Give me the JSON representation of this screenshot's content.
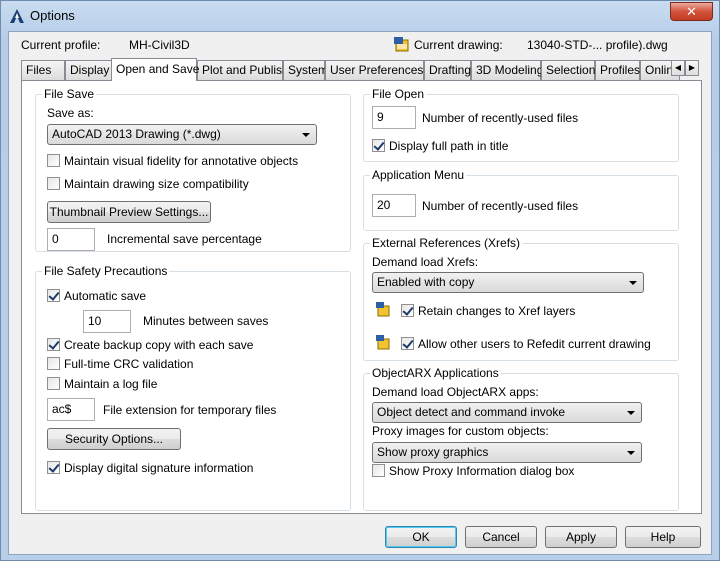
{
  "window": {
    "title": "Options",
    "close_label": "✕"
  },
  "header": {
    "current_profile_label": "Current profile:",
    "current_profile_value": "MH-Civil3D",
    "current_drawing_label": "Current drawing:",
    "current_drawing_value": "13040-STD-... profile).dwg"
  },
  "tabs": [
    "Files",
    "Display",
    "Open and Save",
    "Plot and Publish",
    "System",
    "User Preferences",
    "Drafting",
    "3D Modeling",
    "Selection",
    "Profiles",
    "Online"
  ],
  "active_tab": "Open and Save",
  "file_save": {
    "title": "File Save",
    "save_as_label": "Save as:",
    "save_as_value": "AutoCAD 2013 Drawing (*.dwg)",
    "visual_fidelity_label": "Maintain visual fidelity for annotative objects",
    "visual_fidelity_checked": false,
    "drawing_size_label": "Maintain drawing size compatibility",
    "drawing_size_checked": false,
    "thumbnail_button": "Thumbnail Preview Settings...",
    "incremental_value": "0",
    "incremental_label": "Incremental save percentage"
  },
  "file_safety": {
    "title": "File Safety Precautions",
    "automatic_save_label": "Automatic save",
    "automatic_save_checked": true,
    "minutes_value": "10",
    "minutes_label": "Minutes between saves",
    "backup_label": "Create backup copy with each save",
    "backup_checked": true,
    "crc_label": "Full-time CRC validation",
    "crc_checked": false,
    "log_label": "Maintain a log file",
    "log_checked": false,
    "temp_ext_value": "ac$",
    "temp_ext_label": "File extension for temporary files",
    "security_button": "Security Options...",
    "digital_sig_label": "Display digital signature information",
    "digital_sig_checked": true
  },
  "file_open": {
    "title": "File Open",
    "recent_value": "9",
    "recent_label": "Number of recently-used files",
    "full_path_label": "Display full path in title",
    "full_path_checked": true
  },
  "app_menu": {
    "title": "Application Menu",
    "recent_value": "20",
    "recent_label": "Number of recently-used files"
  },
  "xrefs": {
    "title": "External References (Xrefs)",
    "demand_load_label": "Demand load Xrefs:",
    "demand_load_value": "Enabled with copy",
    "retain_label": "Retain changes to Xref layers",
    "retain_checked": true,
    "allow_label": "Allow other users to Refedit current drawing",
    "allow_checked": true
  },
  "objectarx": {
    "title": "ObjectARX Applications",
    "demand_label": "Demand load ObjectARX apps:",
    "demand_value": "Object detect and command invoke",
    "proxy_label": "Proxy images for custom objects:",
    "proxy_value": "Show proxy graphics",
    "proxy_dialog_label": "Show Proxy Information dialog box",
    "proxy_dialog_checked": false
  },
  "footer": {
    "ok": "OK",
    "cancel": "Cancel",
    "apply": "Apply",
    "help": "Help"
  },
  "colors": {
    "title_bar": "#b9d1ea",
    "close_button": "#c43c22",
    "default_button_border": "#3c7fb1"
  }
}
